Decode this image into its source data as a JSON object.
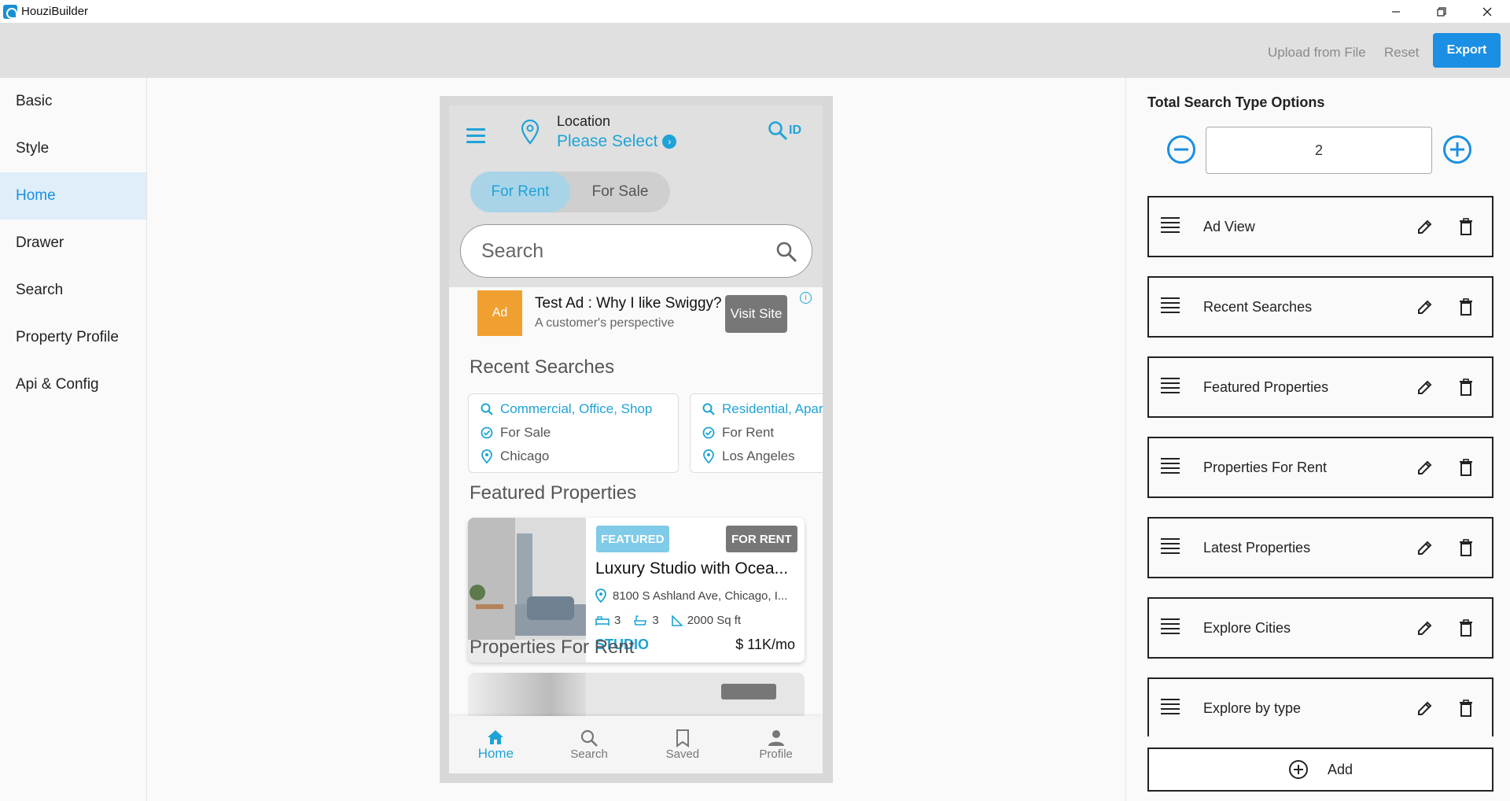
{
  "window": {
    "title": "HouziBuilder",
    "controls": [
      "minimize",
      "restore",
      "close"
    ]
  },
  "toolbar": {
    "upload_label": "Upload from File",
    "reset_label": "Reset",
    "export_label": "Export"
  },
  "sidebar": {
    "items": [
      {
        "label": "Basic",
        "active": false
      },
      {
        "label": "Style",
        "active": false
      },
      {
        "label": "Home",
        "active": true
      },
      {
        "label": "Drawer",
        "active": false
      },
      {
        "label": "Search",
        "active": false
      },
      {
        "label": "Property Profile",
        "active": false
      },
      {
        "label": "Api & Config",
        "active": false
      }
    ]
  },
  "preview": {
    "header": {
      "location_label": "Location",
      "location_value": "Please Select",
      "id_label": "ID"
    },
    "toggle": {
      "options": [
        "For Rent",
        "For Sale"
      ],
      "selected": "For Rent"
    },
    "search_placeholder": "Search",
    "ad": {
      "badge": "Ad",
      "title": "Test Ad : Why I like Swiggy?",
      "subtitle": "A customer's perspective",
      "button": "Visit Site"
    },
    "recent_title": "Recent Searches",
    "recent_searches": [
      {
        "type": "Commercial, Office, Shop",
        "status": "For Sale",
        "city": "Chicago"
      },
      {
        "type": "Residential, Apar",
        "status": "For Rent",
        "city": "Los Angeles"
      }
    ],
    "featured_title": "Featured Properties",
    "featured_property": {
      "badge_featured": "FEATURED",
      "badge_status": "FOR RENT",
      "title": "Luxury Studio with Ocea...",
      "address": "8100 S Ashland Ave, Chicago, I...",
      "beds": "3",
      "baths": "3",
      "area": "2000 Sq ft",
      "type": "STUDIO",
      "price": "$ 11K/mo"
    },
    "rent_title": "Properties For Rent",
    "bottom_nav": [
      {
        "label": "Home",
        "icon": "home-icon",
        "active": true
      },
      {
        "label": "Search",
        "icon": "search-icon",
        "active": false
      },
      {
        "label": "Saved",
        "icon": "bookmark-icon",
        "active": false
      },
      {
        "label": "Profile",
        "icon": "person-icon",
        "active": false
      }
    ]
  },
  "right_panel": {
    "title": "Total Search Type Options",
    "count": "2",
    "options": [
      "Ad View",
      "Recent Searches",
      "Featured Properties",
      "Properties For Rent",
      "Latest Properties",
      "Explore Cities",
      "Explore by type"
    ],
    "add_label": "Add"
  },
  "colors": {
    "accent": "#1fa3d6",
    "export": "#1a8fe3",
    "ad_badge": "#f0a030"
  }
}
